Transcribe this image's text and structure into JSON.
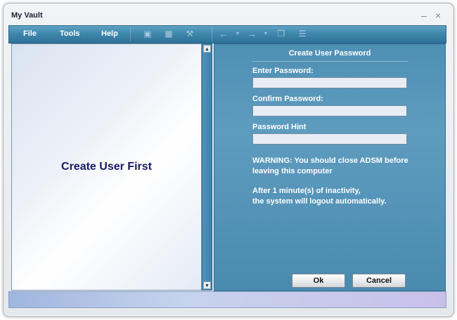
{
  "window": {
    "title": "My Vault",
    "minimize": "–",
    "close": "×"
  },
  "menu": {
    "file": "File",
    "tools": "Tools",
    "help": "Help"
  },
  "toolbar_icons": [
    "doc-icon",
    "grid-icon",
    "wrench-icon",
    "back-arrow-icon",
    "forward-arrow-icon",
    "copy-icon",
    "list-icon"
  ],
  "left_panel": {
    "message": "Create User First"
  },
  "form": {
    "title": "Create User Password",
    "password_label": "Enter Password:",
    "password_value": "",
    "confirm_label": "Confirm Password:",
    "confirm_value": "",
    "hint_label": "Password Hint",
    "hint_value": "",
    "warning_line1": "WARNING: You should close ADSM before",
    "warning_line2": "leaving this computer",
    "inactivity_line1": "After 1 minute(s) of inactivity,",
    "inactivity_line2": "the system will logout automatically.",
    "ok": "Ok",
    "cancel": "Cancel"
  }
}
